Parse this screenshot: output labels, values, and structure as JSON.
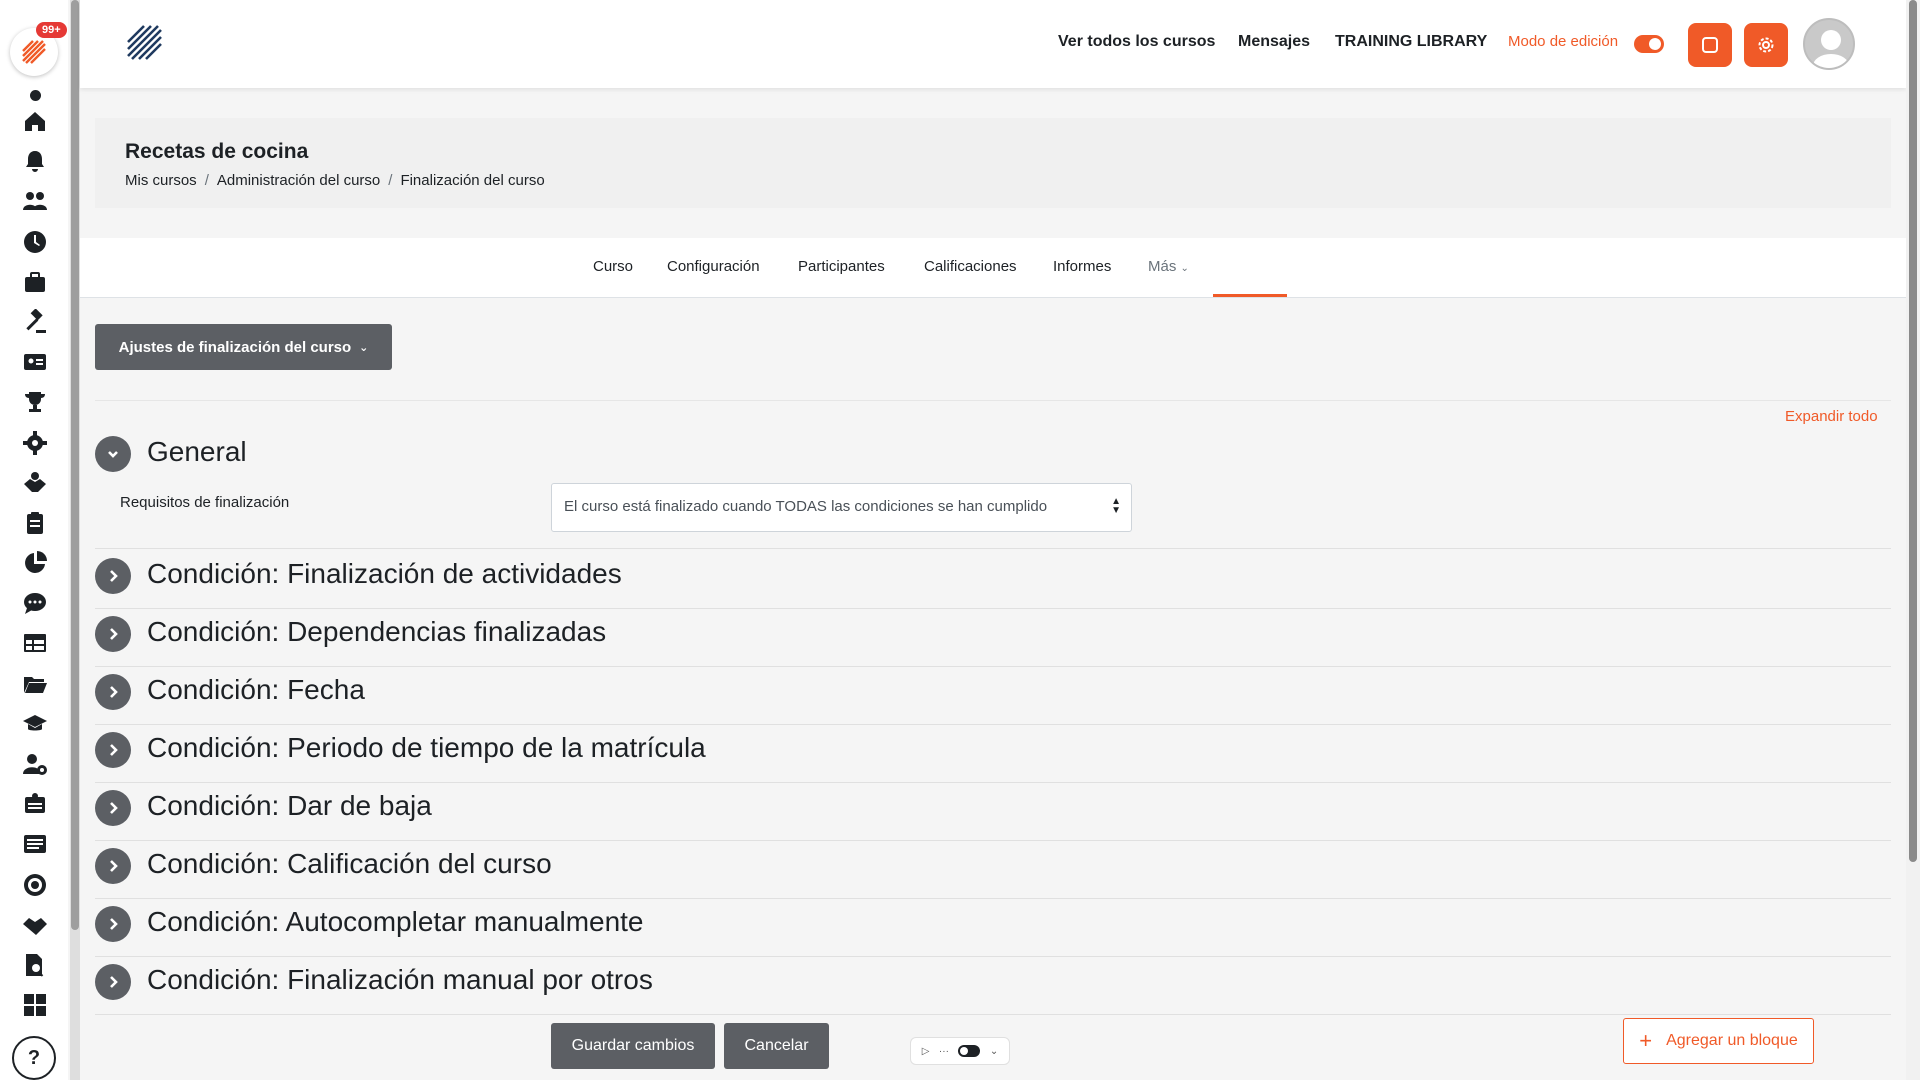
{
  "rail": {
    "badge": "99+",
    "icons": [
      "home-icon",
      "bell-icon",
      "users-icon",
      "clock-icon",
      "briefcase-icon",
      "gavel-icon",
      "id-card-icon",
      "trophy-icon",
      "gear-icon",
      "handshake-dollar-icon",
      "clipboard-icon",
      "pie-chart-icon",
      "chat-icon",
      "table-icon",
      "folder-open-icon",
      "graduation-cap-icon",
      "user-cog-icon",
      "certificate-icon",
      "list-icon",
      "target-icon",
      "handshake-icon",
      "file-search-icon",
      "grid-icon"
    ],
    "help_label": "?"
  },
  "topnav": {
    "links": [
      "Ver todos los cursos",
      "Mensajes",
      "TRAINING LIBRARY"
    ],
    "edit_mode_label": "Modo de edición",
    "edit_mode_on": true
  },
  "header": {
    "title": "Recetas de cocina",
    "breadcrumbs": [
      "Mis cursos",
      "Administración del curso",
      "Finalización del curso"
    ]
  },
  "tabs": [
    "Curso",
    "Configuración",
    "Participantes",
    "Calificaciones",
    "Informes",
    "Más"
  ],
  "active_tab": "Más",
  "action_menu": "Ajustes de finalización del curso",
  "expand_all": "Expandir todo",
  "general": {
    "title": "General",
    "requirement_label": "Requisitos de finalización",
    "requirement_value": "El curso está finalizado cuando TODAS las condiciones se han cumplido"
  },
  "conditions": [
    "Condición: Finalización de actividades",
    "Condición: Dependencias finalizadas",
    "Condición: Fecha",
    "Condición: Periodo de tiempo de la matrícula",
    "Condición: Dar de baja",
    "Condición: Calificación del curso",
    "Condición: Autocompletar manualmente",
    "Condición: Finalización manual por otros"
  ],
  "buttons": {
    "save": "Guardar cambios",
    "cancel": "Cancelar",
    "add_block": "Agregar un bloque"
  },
  "colors": {
    "accent": "#f05a28",
    "button": "#5c5f64"
  }
}
